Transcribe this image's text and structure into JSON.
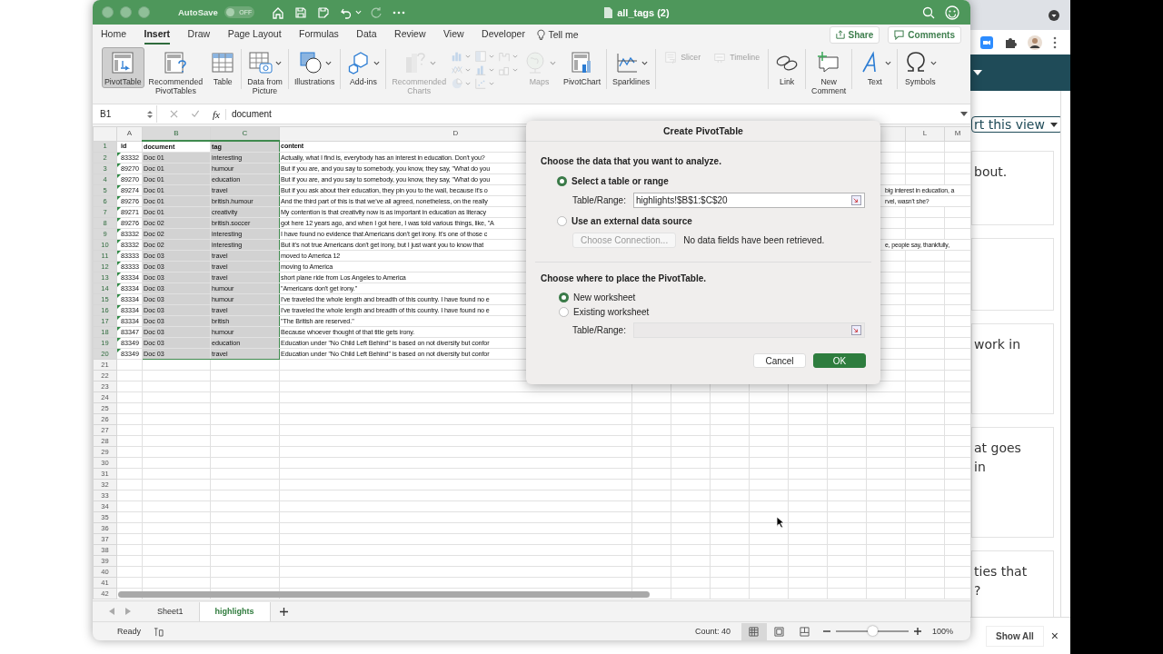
{
  "browser": {
    "export_button": "rt this view",
    "cards": [
      {
        "kind": "text",
        "lines": [
          "bout."
        ]
      },
      {
        "kind": "blank"
      },
      {
        "kind": "text",
        "lines": [
          "work in"
        ]
      },
      {
        "kind": "text",
        "lines": [
          "at goes",
          "in"
        ]
      },
      {
        "kind": "text",
        "lines": [
          "ties that",
          "?"
        ]
      }
    ],
    "show_all": "Show All",
    "close": "×"
  },
  "excel": {
    "title_bar": {
      "autosave": {
        "label": "AutoSave",
        "toggle": "OFF",
        "on": false
      },
      "title": "all_tags (2)"
    },
    "tabs": [
      {
        "label": "Home",
        "selected": false
      },
      {
        "label": "Insert",
        "selected": true
      },
      {
        "label": "Draw",
        "selected": false
      },
      {
        "label": "Page Layout",
        "selected": false
      },
      {
        "label": "Formulas",
        "selected": false
      },
      {
        "label": "Data",
        "selected": false
      },
      {
        "label": "Review",
        "selected": false
      },
      {
        "label": "View",
        "selected": false
      },
      {
        "label": "Developer",
        "selected": false
      }
    ],
    "tell_me": "Tell me",
    "share": "Share",
    "comments": "Comments",
    "ribbon": [
      [
        {
          "kind": "large",
          "lines": [
            "PivotTable"
          ],
          "selected": true,
          "disabled": false,
          "dropdown": false
        },
        {
          "kind": "large",
          "lines": [
            "Recommended",
            "PivotTables"
          ],
          "selected": false,
          "disabled": false,
          "dropdown": false
        },
        {
          "kind": "large",
          "lines": [
            "Table"
          ],
          "selected": false,
          "disabled": false,
          "dropdown": false
        }
      ],
      [
        {
          "kind": "large",
          "lines": [
            "Data from",
            "Picture"
          ],
          "selected": false,
          "disabled": false,
          "dropdown": true
        }
      ],
      [
        {
          "kind": "large",
          "lines": [
            "Illustrations"
          ],
          "selected": false,
          "disabled": false,
          "dropdown": true
        }
      ],
      [
        {
          "kind": "large",
          "lines": [
            "Add-ins"
          ],
          "selected": false,
          "disabled": false,
          "dropdown": true
        }
      ],
      [
        {
          "kind": "large",
          "lines": [
            "Recommended",
            "Charts"
          ],
          "selected": false,
          "disabled": true,
          "dropdown": true
        },
        {
          "kind": "chart-grid",
          "disabled": true
        },
        {
          "kind": "large",
          "lines": [
            "Maps"
          ],
          "selected": false,
          "disabled": true,
          "dropdown": true
        },
        {
          "kind": "large",
          "lines": [
            "PivotChart"
          ],
          "selected": false,
          "disabled": false,
          "dropdown": false
        }
      ],
      [
        {
          "kind": "large",
          "lines": [
            "Sparklines"
          ],
          "selected": false,
          "disabled": false,
          "dropdown": true
        }
      ],
      [
        {
          "kind": "small",
          "lines": [
            "Slicer"
          ],
          "disabled": true
        },
        {
          "kind": "small",
          "lines": [
            "Timeline"
          ],
          "disabled": true
        }
      ],
      [
        {
          "kind": "large",
          "lines": [
            "Link"
          ],
          "selected": false,
          "disabled": false,
          "dropdown": false
        }
      ],
      [
        {
          "kind": "large",
          "lines": [
            "New",
            "Comment"
          ],
          "selected": false,
          "disabled": false,
          "dropdown": false
        }
      ],
      [
        {
          "kind": "large",
          "lines": [
            "Text"
          ],
          "selected": false,
          "disabled": false,
          "dropdown": true
        }
      ],
      [
        {
          "kind": "large",
          "lines": [
            "Symbols"
          ],
          "selected": false,
          "disabled": false,
          "dropdown": true
        }
      ]
    ],
    "formula_bar": {
      "name_box": "B1",
      "fx": "fx",
      "value": "document"
    },
    "columns": [
      {
        "kind": "lettered",
        "label": "A",
        "selected": false
      },
      {
        "kind": "lettered",
        "label": "B",
        "selected": true
      },
      {
        "kind": "lettered",
        "label": "C",
        "selected": true
      },
      {
        "kind": "lettered",
        "label": "D",
        "selected": false
      },
      {
        "kind": "covered"
      },
      {
        "kind": "covered"
      },
      {
        "kind": "covered"
      },
      {
        "kind": "covered"
      },
      {
        "kind": "covered"
      },
      {
        "kind": "covered"
      },
      {
        "kind": "covered"
      },
      {
        "kind": "lettered",
        "label": "L",
        "selected": false
      },
      {
        "kind": "lettered",
        "label": "M",
        "selected": false
      }
    ],
    "rows": [
      {
        "number": "1",
        "kind": "header",
        "selected": true,
        "cells": [
          "id",
          "document",
          "tag",
          "content"
        ]
      },
      {
        "number": "2",
        "kind": "data",
        "selected": true,
        "cells": [
          "83332",
          "Doc 01",
          "interesting",
          "Actually, what I find is, everybody has an interest in education. Don't you?"
        ]
      },
      {
        "number": "3",
        "kind": "data",
        "selected": true,
        "cells": [
          "89270",
          "Doc 01",
          "humour",
          "But if you are, and you say to somebody, you know, they say, \"What do you"
        ]
      },
      {
        "number": "4",
        "kind": "data",
        "selected": true,
        "cells": [
          "89270",
          "Doc 01",
          "education",
          "But if you are, and you say to somebody, you know, they say, \"What do you"
        ]
      },
      {
        "number": "5",
        "kind": "data",
        "selected": true,
        "cells": [
          "89274",
          "Doc 01",
          "travel",
          "But if you ask about their education, they pin you to the wall, because it's o"
        ],
        "tail": "big interest in education, a"
      },
      {
        "number": "6",
        "kind": "data",
        "selected": true,
        "cells": [
          "89276",
          "Doc 01",
          "british.humour",
          "And the third part of this is that we've all agreed, nonetheless, on the really"
        ],
        "tail": "rvel, wasn't she?"
      },
      {
        "number": "7",
        "kind": "data",
        "selected": true,
        "cells": [
          "89271",
          "Doc 01",
          "creativity",
          "My contention is that creativity now is as important in education as literacy"
        ]
      },
      {
        "number": "8",
        "kind": "data",
        "selected": true,
        "cells": [
          "89276",
          "Doc 02",
          "british.soccer",
          "got here 12 years ago, and when I got here, I was told various things, like, \"A"
        ]
      },
      {
        "number": "9",
        "kind": "data",
        "selected": true,
        "cells": [
          "83332",
          "Doc 02",
          "interesting",
          "I have found no evidence that Americans don't get irony. It's one of those c"
        ]
      },
      {
        "number": "10",
        "kind": "data",
        "selected": true,
        "cells": [
          "83332",
          "Doc 02",
          "interesting",
          "But it's not true Americans don't get irony, but I just want you to know that"
        ],
        "tail": "e, people say, thankfully,"
      },
      {
        "number": "11",
        "kind": "data",
        "selected": true,
        "cells": [
          "83333",
          "Doc 03",
          "travel",
          "moved to America 12"
        ]
      },
      {
        "number": "12",
        "kind": "data",
        "selected": true,
        "cells": [
          "83333",
          "Doc 03",
          "travel",
          "moving to America"
        ]
      },
      {
        "number": "13",
        "kind": "data",
        "selected": true,
        "cells": [
          "83334",
          "Doc 03",
          "travel",
          "short plane ride from Los Angeles to America"
        ]
      },
      {
        "number": "14",
        "kind": "data",
        "selected": true,
        "cells": [
          "83334",
          "Doc 03",
          "humour",
          "\"Americans don't get irony.\""
        ]
      },
      {
        "number": "15",
        "kind": "data",
        "selected": true,
        "cells": [
          "83334",
          "Doc 03",
          "humour",
          "I've traveled the whole length and breadth of this country. I have found no e"
        ]
      },
      {
        "number": "16",
        "kind": "data",
        "selected": true,
        "cells": [
          "83334",
          "Doc 03",
          "travel",
          "I've traveled the whole length and breadth of this country. I have found no e"
        ]
      },
      {
        "number": "17",
        "kind": "data",
        "selected": true,
        "cells": [
          "83334",
          "Doc 03",
          "british",
          "\"The British are reserved.\""
        ]
      },
      {
        "number": "18",
        "kind": "data",
        "selected": true,
        "cells": [
          "83347",
          "Doc 03",
          "humour",
          "Because whoever thought of that title gets irony."
        ]
      },
      {
        "number": "19",
        "kind": "data",
        "selected": true,
        "cells": [
          "83349",
          "Doc 03",
          "education",
          "Education under \"No Child Left Behind\" is based on not diversity but confor"
        ]
      },
      {
        "number": "20",
        "kind": "data",
        "selected": true,
        "cells": [
          "83349",
          "Doc 03",
          "travel",
          "Education under \"No Child Left Behind\" is based on not diversity but confor"
        ]
      },
      {
        "number": "21",
        "kind": "empty",
        "selected": false
      },
      {
        "number": "22",
        "kind": "empty",
        "selected": false
      },
      {
        "number": "23",
        "kind": "empty",
        "selected": false
      },
      {
        "number": "24",
        "kind": "empty",
        "selected": false
      },
      {
        "number": "25",
        "kind": "empty",
        "selected": false
      },
      {
        "number": "26",
        "kind": "empty",
        "selected": false
      },
      {
        "number": "27",
        "kind": "empty",
        "selected": false
      },
      {
        "number": "28",
        "kind": "empty",
        "selected": false
      },
      {
        "number": "29",
        "kind": "empty",
        "selected": false
      },
      {
        "number": "30",
        "kind": "empty",
        "selected": false
      },
      {
        "number": "31",
        "kind": "empty",
        "selected": false
      },
      {
        "number": "32",
        "kind": "empty",
        "selected": false
      },
      {
        "number": "33",
        "kind": "empty",
        "selected": false
      },
      {
        "number": "34",
        "kind": "empty",
        "selected": false
      },
      {
        "number": "35",
        "kind": "empty",
        "selected": false
      },
      {
        "number": "36",
        "kind": "empty",
        "selected": false
      },
      {
        "number": "37",
        "kind": "empty",
        "selected": false
      },
      {
        "number": "38",
        "kind": "empty",
        "selected": false
      },
      {
        "number": "39",
        "kind": "empty",
        "selected": false
      },
      {
        "number": "40",
        "kind": "empty",
        "selected": false
      },
      {
        "number": "41",
        "kind": "empty",
        "selected": false
      },
      {
        "number": "42",
        "kind": "empty",
        "selected": false
      }
    ],
    "sheets": [
      {
        "label": "Sheet1",
        "selected": false
      },
      {
        "label": "highlights",
        "selected": true
      }
    ],
    "status_bar": {
      "mode": "Ready",
      "count": "Count: 40",
      "views": [
        {
          "selected": true
        },
        {
          "selected": false
        },
        {
          "selected": false
        }
      ],
      "zoom": {
        "level": 0.5,
        "reading": "100%"
      }
    },
    "dialog": {
      "title": "Create PivotTable",
      "source_heading": "Choose the data that you want to analyze.",
      "source_options": [
        {
          "label": "Select a table or range",
          "selected": true
        },
        {
          "label": "Use an external data source",
          "selected": false
        }
      ],
      "range_label": "Table/Range:",
      "range_value": "highlights!$B$1:$C$20",
      "connection_button": {
        "label": "Choose Connection...",
        "disabled": true
      },
      "connection_note": "No data fields have been retrieved.",
      "place_heading": "Choose where to place the PivotTable.",
      "place_options": [
        {
          "label": "New worksheet",
          "selected": true
        },
        {
          "label": "Existing worksheet",
          "selected": false
        }
      ],
      "place_range": {
        "label": "Table/Range:",
        "disabled": true
      },
      "buttons": [
        {
          "label": "Cancel",
          "kind": "secondary"
        },
        {
          "label": "OK",
          "kind": "primary"
        }
      ]
    }
  }
}
